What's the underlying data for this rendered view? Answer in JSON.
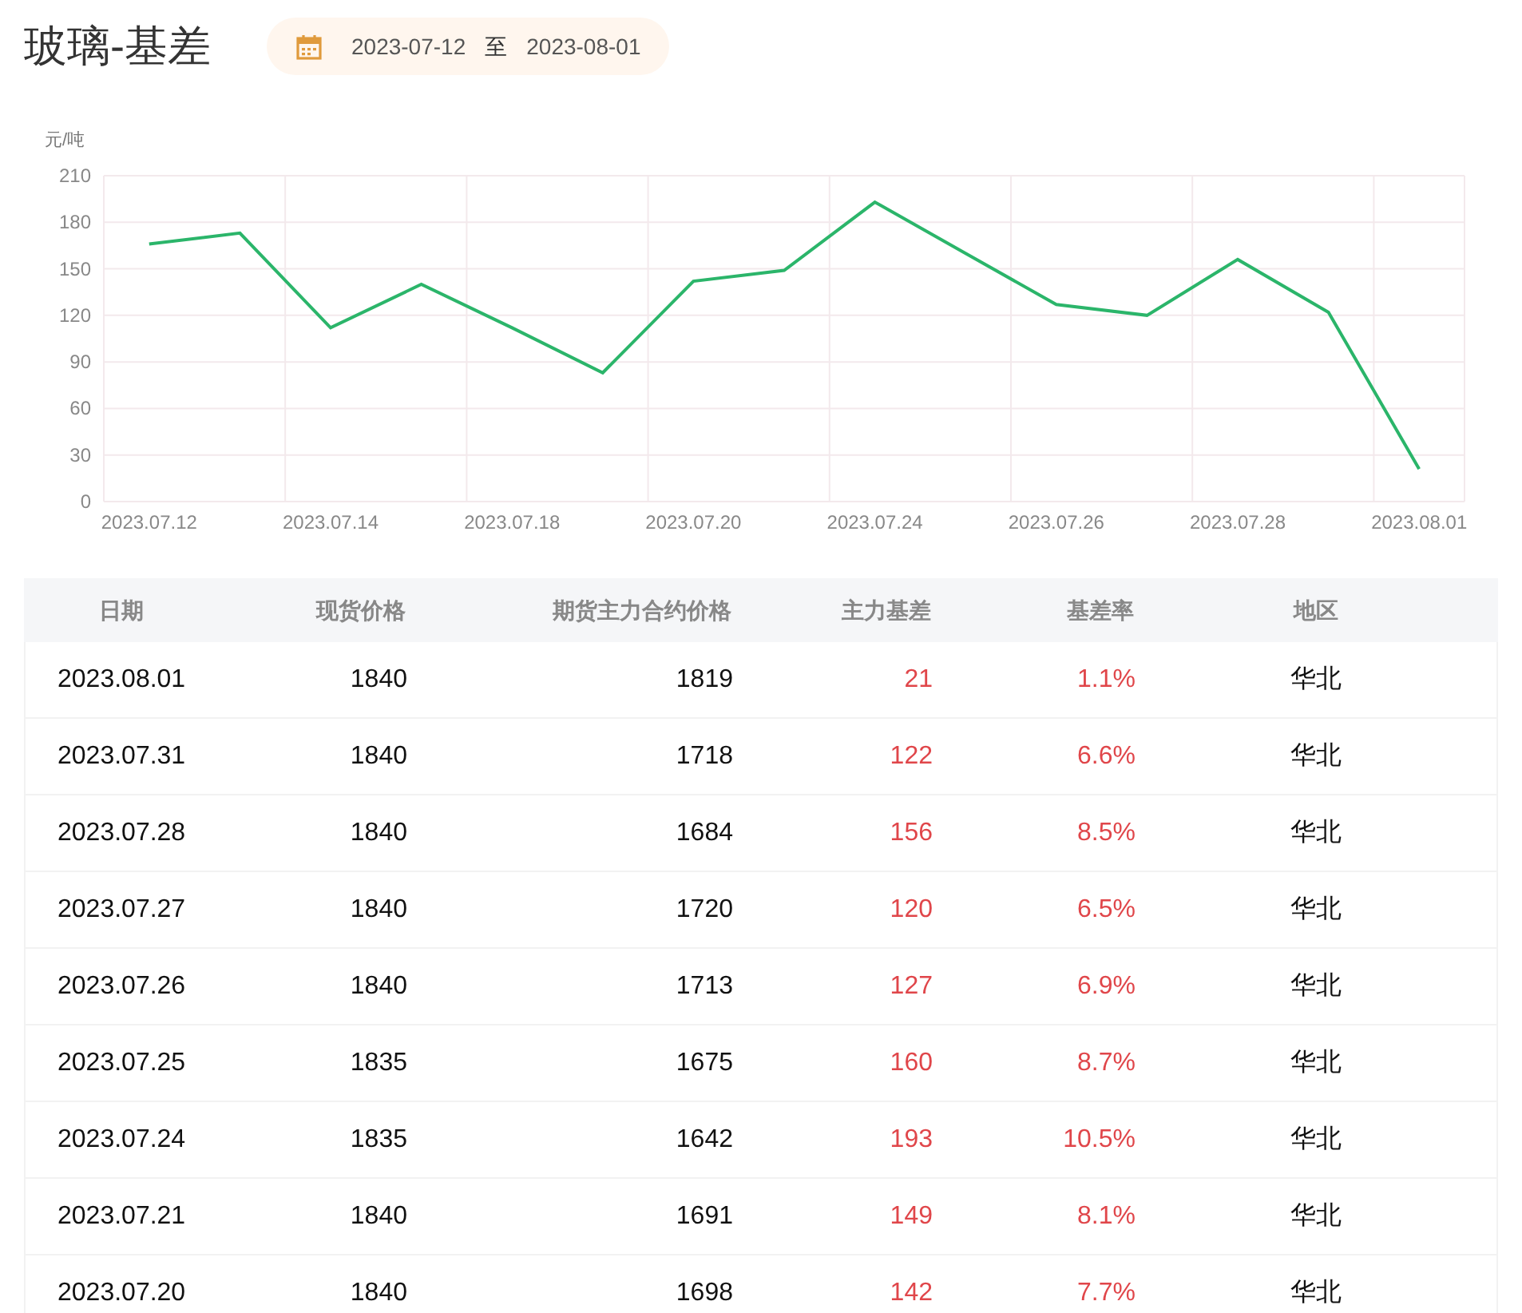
{
  "title": "玻璃-基差",
  "date_range": {
    "start": "2023-07-12",
    "separator": "至",
    "end": "2023-08-01"
  },
  "chart": {
    "chart_data": {
      "type": "line",
      "ylabel": "元/吨",
      "grid": true,
      "categories": [
        "2023.07.12",
        null,
        "2023.07.14",
        null,
        "2023.07.18",
        null,
        "2023.07.20",
        null,
        "2023.07.24",
        null,
        "2023.07.26",
        null,
        "2023.07.28",
        null,
        "2023.08.01"
      ],
      "series": [
        {
          "color": "#2bb56a",
          "values": [
            166,
            173,
            112,
            140,
            112,
            83,
            142,
            149,
            193,
            160,
            127,
            120,
            156,
            122,
            21
          ]
        }
      ],
      "ylim": [
        0,
        210
      ],
      "yticks": [
        0,
        30,
        60,
        90,
        120,
        150,
        180,
        210
      ]
    }
  },
  "table": {
    "columns": [
      "日期",
      "现货价格",
      "期货主力合约价格",
      "主力基差",
      "基差率",
      "地区"
    ],
    "rows": [
      [
        "2023.08.01",
        "1840",
        "1819",
        "21",
        "1.1%",
        "华北"
      ],
      [
        "2023.07.31",
        "1840",
        "1718",
        "122",
        "6.6%",
        "华北"
      ],
      [
        "2023.07.28",
        "1840",
        "1684",
        "156",
        "8.5%",
        "华北"
      ],
      [
        "2023.07.27",
        "1840",
        "1720",
        "120",
        "6.5%",
        "华北"
      ],
      [
        "2023.07.26",
        "1840",
        "1713",
        "127",
        "6.9%",
        "华北"
      ],
      [
        "2023.07.25",
        "1835",
        "1675",
        "160",
        "8.7%",
        "华北"
      ],
      [
        "2023.07.24",
        "1835",
        "1642",
        "193",
        "10.5%",
        "华北"
      ],
      [
        "2023.07.21",
        "1840",
        "1691",
        "149",
        "8.1%",
        "华北"
      ],
      [
        "2023.07.20",
        "1840",
        "1698",
        "142",
        "7.7%",
        "华北"
      ]
    ]
  }
}
